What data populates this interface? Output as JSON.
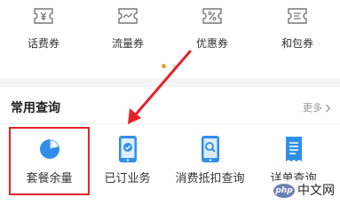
{
  "vouchers": [
    {
      "label": "话费券",
      "icon": "yuan-ticket-icon"
    },
    {
      "label": "流量券",
      "icon": "data-wave-ticket-icon"
    },
    {
      "label": "优惠券",
      "icon": "percent-ticket-icon"
    },
    {
      "label": "和包券",
      "icon": "wallet-ticket-icon"
    }
  ],
  "carousel": {
    "page_count": 2,
    "active_index": 0
  },
  "section": {
    "title": "常用查询",
    "more_label": "更多"
  },
  "queries": [
    {
      "label": "套餐余量",
      "icon": "pie-chart-icon"
    },
    {
      "label": "已订业务",
      "icon": "phone-check-icon"
    },
    {
      "label": "消费抵扣查询",
      "icon": "phone-search-icon"
    },
    {
      "label": "详单查询",
      "icon": "receipt-list-icon"
    }
  ],
  "annotation": {
    "target": "套餐余量",
    "color": "#e5232a"
  },
  "watermark": {
    "logo_text": "php",
    "text": "中文网"
  },
  "colors": {
    "accent_blue": "#2f8fe8",
    "icon_gray": "#777777",
    "dot_active": "#f0a030",
    "dot_inactive": "#dddddd",
    "section_bg": "#f4f4f4"
  }
}
